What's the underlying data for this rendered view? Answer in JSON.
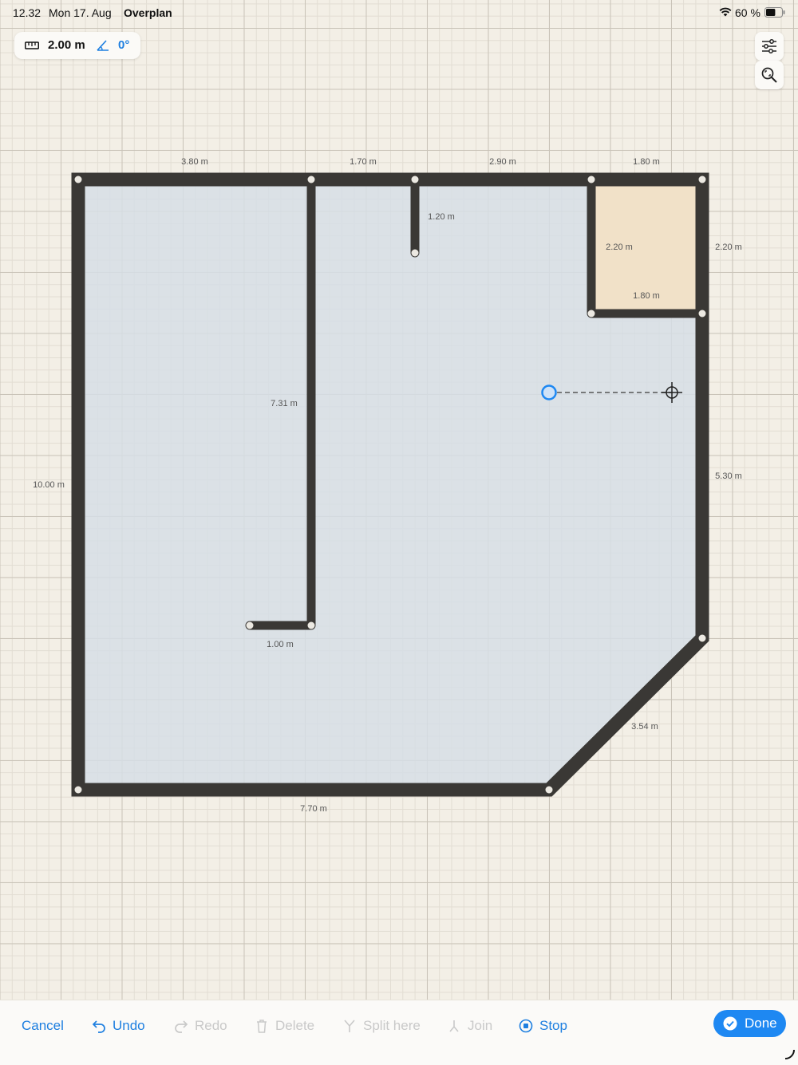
{
  "status_bar": {
    "time": "12.32",
    "date": "Mon 17. Aug",
    "app_name": "Overplan",
    "battery_percent": "60 %",
    "battery_level": 0.6
  },
  "measure_pill": {
    "length": "2.00 m",
    "angle": "0°"
  },
  "side_buttons": [
    {
      "icon": "sliders-icon"
    },
    {
      "icon": "zoom-fit-icon"
    }
  ],
  "dimension_labels": [
    {
      "id": "dim-top-1",
      "text": "3.80 m"
    },
    {
      "id": "dim-top-2",
      "text": "1.70 m"
    },
    {
      "id": "dim-top-3",
      "text": "2.90 m"
    },
    {
      "id": "dim-top-4",
      "text": "1.80 m"
    },
    {
      "id": "dim-stub",
      "text": "1.20 m"
    },
    {
      "id": "dim-small-left",
      "text": "2.20 m"
    },
    {
      "id": "dim-small-bottom",
      "text": "1.80 m"
    },
    {
      "id": "dim-right-top",
      "text": "2.20 m"
    },
    {
      "id": "dim-partition",
      "text": "7.31 m"
    },
    {
      "id": "dim-left",
      "text": "10.00 m"
    },
    {
      "id": "dim-right-main",
      "text": "5.30 m"
    },
    {
      "id": "dim-partition-foot",
      "text": "1.00 m"
    },
    {
      "id": "dim-diagonal",
      "text": "3.54 m"
    },
    {
      "id": "dim-bottom",
      "text": "7.70 m"
    }
  ],
  "colors": {
    "wall": "#3a3835",
    "floor_main": "#d6dee5",
    "floor_small_room": "#f1e1c8",
    "accent": "#1e7fe0",
    "canvas": "#f3efe6"
  },
  "toolbar": {
    "cancel": "Cancel",
    "undo": "Undo",
    "redo": "Redo",
    "delete": "Delete",
    "split_here": "Split here",
    "join": "Join",
    "stop": "Stop",
    "done": "Done"
  }
}
